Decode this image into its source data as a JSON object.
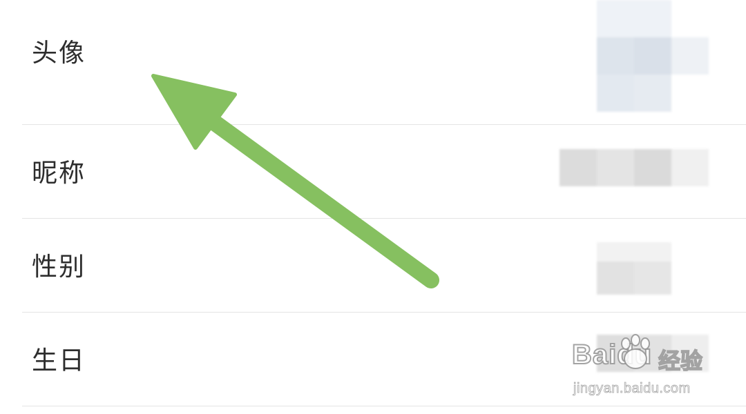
{
  "rows": [
    {
      "label": "头像"
    },
    {
      "label": "昵称"
    },
    {
      "label": "性别"
    },
    {
      "label": "生日"
    }
  ],
  "watermark": {
    "brand": "Baidu",
    "cn": "经验",
    "url": "jingyan.baidu.com"
  },
  "colors": {
    "arrow": "#86c060",
    "divider": "#e4e4e4",
    "text": "#2d2d2d"
  },
  "icons": {
    "arrow": "annotation-arrow-icon",
    "paw": "baidu-paw-icon"
  }
}
